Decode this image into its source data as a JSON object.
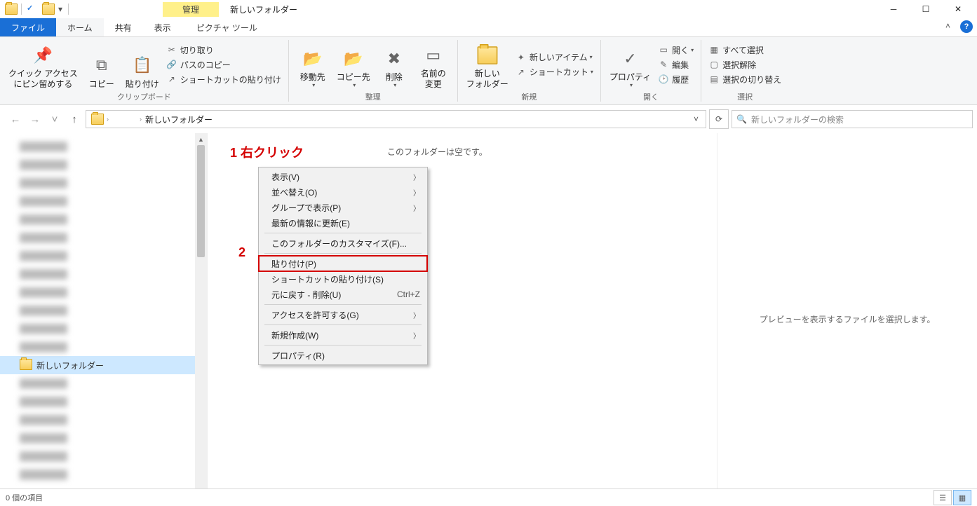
{
  "title": "新しいフォルダー",
  "contextual_tab": "管理",
  "contextual_sub": "ピクチャ ツール",
  "tabs": {
    "file": "ファイル",
    "home": "ホーム",
    "share": "共有",
    "view": "表示"
  },
  "ribbon": {
    "clipboard": {
      "label": "クリップボード",
      "pin": "クイック アクセス\nにピン留めする",
      "copy": "コピー",
      "paste": "貼り付け",
      "cut": "切り取り",
      "copypath": "パスのコピー",
      "paste_shortcut": "ショートカットの貼り付け"
    },
    "organize": {
      "label": "整理",
      "moveto": "移動先",
      "copyto": "コピー先",
      "delete": "削除",
      "rename": "名前の\n変更"
    },
    "new": {
      "label": "新規",
      "newfolder": "新しい\nフォルダー",
      "newitem": "新しいアイテム",
      "shortcut": "ショートカット"
    },
    "open": {
      "label": "開く",
      "properties": "プロパティ",
      "open": "開く",
      "edit": "編集",
      "history": "履歴"
    },
    "select": {
      "label": "選択",
      "all": "すべて選択",
      "none": "選択解除",
      "invert": "選択の切り替え"
    }
  },
  "breadcrumb": {
    "current": "新しいフォルダー"
  },
  "search_placeholder": "新しいフォルダーの検索",
  "tree": {
    "selected": "新しいフォルダー"
  },
  "empty_folder_msg": "このフォルダーは空です。",
  "preview_msg": "プレビューを表示するファイルを選択します。",
  "annotations": {
    "a1": "1 右クリック",
    "a2": "2"
  },
  "context_menu": {
    "view": "表示(V)",
    "sort": "並べ替え(O)",
    "groupby": "グループで表示(P)",
    "refresh": "最新の情報に更新(E)",
    "customize": "このフォルダーのカスタマイズ(F)...",
    "paste": "貼り付け(P)",
    "paste_shortcut": "ショートカットの貼り付け(S)",
    "undo": "元に戻す - 削除(U)",
    "undo_accel": "Ctrl+Z",
    "access": "アクセスを許可する(G)",
    "new": "新規作成(W)",
    "properties": "プロパティ(R)"
  },
  "status": "0 個の項目"
}
